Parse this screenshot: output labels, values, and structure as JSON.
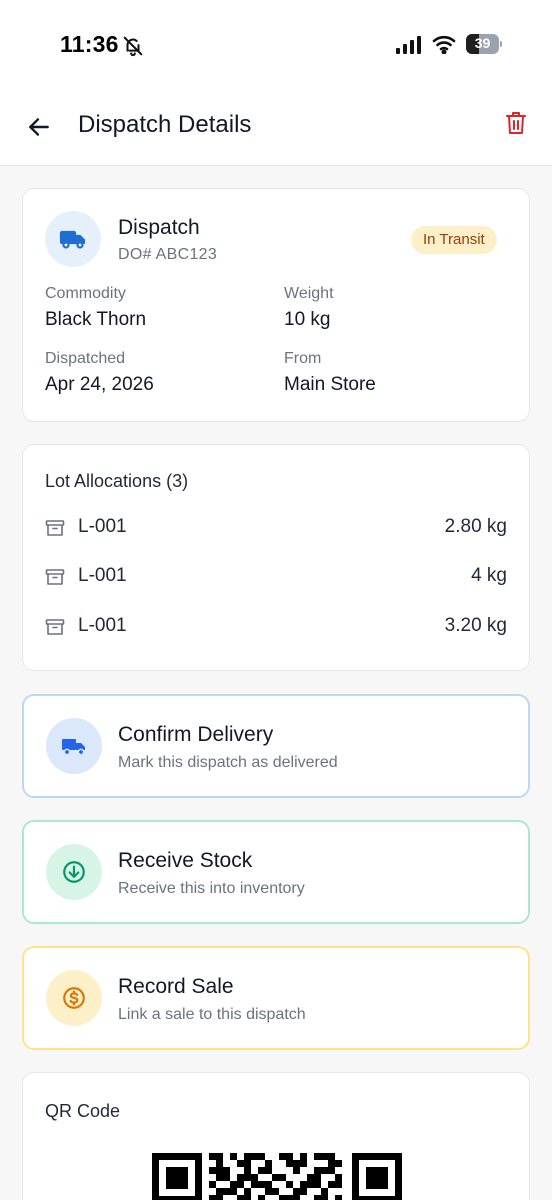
{
  "status_bar": {
    "time": "11:36",
    "battery": "39",
    "icons": [
      "bell-slash-icon",
      "signal-icon",
      "wifi-icon",
      "battery-icon"
    ]
  },
  "header": {
    "title": "Dispatch Details",
    "back_icon": "arrow-left-icon",
    "delete_icon": "trash-icon",
    "delete_color": "#dc2626"
  },
  "summary": {
    "icon": "truck-icon",
    "title": "Dispatch",
    "order_number": "DO# ABC123",
    "status": "In Transit",
    "fields": {
      "commodity": {
        "label": "Commodity",
        "value": "Black Thorn"
      },
      "weight": {
        "label": "Weight",
        "value": "10 kg"
      },
      "dispatched": {
        "label": "Dispatched",
        "value": "Apr 24, 2026"
      },
      "from": {
        "label": "From",
        "value": "Main Store"
      }
    }
  },
  "lots": {
    "title": "Lot Allocations (3)",
    "icon": "archive-box-icon",
    "items": [
      {
        "name": "L-001",
        "qty": "2.80 kg"
      },
      {
        "name": "L-001",
        "qty": "4 kg"
      },
      {
        "name": "L-001",
        "qty": "3.20 kg"
      }
    ]
  },
  "actions": {
    "confirm_delivery": {
      "title": "Confirm Delivery",
      "subtitle": "Mark this dispatch as delivered",
      "icon": "truck-icon",
      "accent": "#2563eb"
    },
    "receive_stock": {
      "title": "Receive Stock",
      "subtitle": "Receive this into inventory",
      "icon": "download-circle-icon",
      "accent": "#059669"
    },
    "record_sale": {
      "title": "Record Sale",
      "subtitle": "Link a sale to this dispatch",
      "icon": "dollar-circle-icon",
      "accent": "#d97706"
    }
  },
  "qr": {
    "title": "QR Code"
  }
}
